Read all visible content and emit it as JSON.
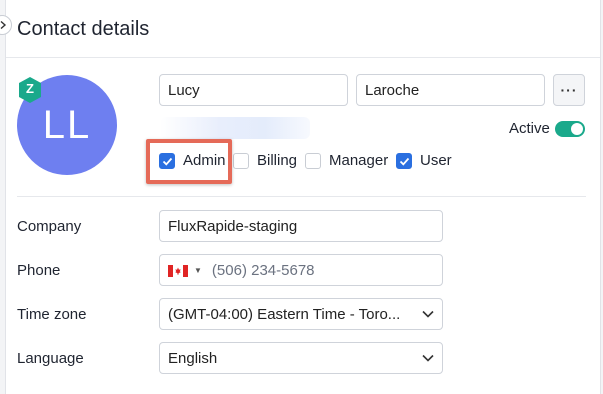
{
  "panel": {
    "title": "Contact details"
  },
  "avatar": {
    "initials": "LL",
    "badge_letter": "Z",
    "color": "#6e7ff0",
    "badge_color": "#1aa98b"
  },
  "name": {
    "first_name": "Lucy",
    "last_name": "Laroche",
    "more_label": "···"
  },
  "status": {
    "active_label": "Active",
    "active": true
  },
  "roles": [
    {
      "label": "Admin",
      "checked": true
    },
    {
      "label": "Billing",
      "checked": false
    },
    {
      "label": "Manager",
      "checked": false
    },
    {
      "label": "User",
      "checked": true
    }
  ],
  "fields": {
    "company_label": "Company",
    "company_value": "FluxRapide-staging",
    "phone_label": "Phone",
    "phone_country": "CA",
    "phone_placeholder": "(506) 234-5678",
    "timezone_label": "Time zone",
    "timezone_value": "(GMT-04:00) Eastern Time - Toro...",
    "language_label": "Language",
    "language_value": "English"
  },
  "colors": {
    "accent": "#2a6fe0",
    "toggle_on": "#1aa98b",
    "highlight": "#e56a58"
  }
}
